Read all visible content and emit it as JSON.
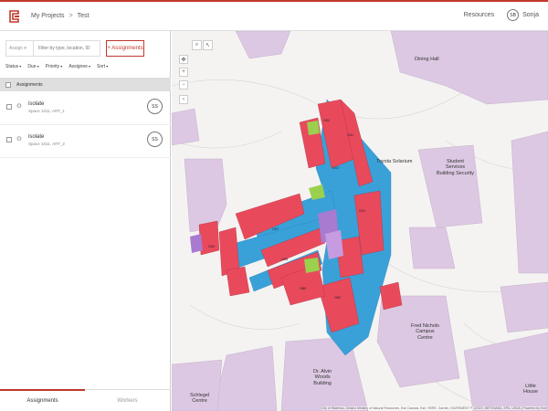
{
  "header": {
    "breadcrumb_root": "My Projects",
    "breadcrumb_sep": ">",
    "breadcrumb_current": "Test",
    "resources_label": "Resources",
    "avatar_initials": "SB",
    "user_name": "Sonja"
  },
  "sidebar": {
    "assignee_dropdown": "Assign",
    "search_placeholder": "Filter by type, location, ID",
    "assignments_button": "+ Assignments",
    "filters": [
      "Status",
      "Due",
      "Priority",
      "Assignee",
      "Sort"
    ],
    "list_header": "Assignments",
    "items": [
      {
        "name": "isolate",
        "sub": "Space 1011, ART_1",
        "badge": "SS"
      },
      {
        "name": "isolate",
        "sub": "Space 1011, ART_2",
        "badge": "SS"
      }
    ],
    "tabs": [
      {
        "label": "Assignments",
        "active": true
      },
      {
        "label": "Workers",
        "active": false
      }
    ]
  },
  "map": {
    "labels": {
      "dining_hall": "Dining Hall",
      "toyota": "Toyota Solarium",
      "student_services": "Student\nServices\nBuilding Security",
      "fred_nichols": "Fred Nichols\nCampus\nCentre",
      "alvin_woods": "Dr. Alvin\nWoods\nBuilding",
      "schlegel": "Schlegel\nCentre",
      "little_house": "Little\nHouse"
    },
    "attribution": "City of Waterloo, Ontario Ministry of Natural Resources, Esri Canada, Esri, HERE, Garmin, INCREMENT P, USGS, METI/NASA, EPA, USDA | Powered by Esri"
  }
}
